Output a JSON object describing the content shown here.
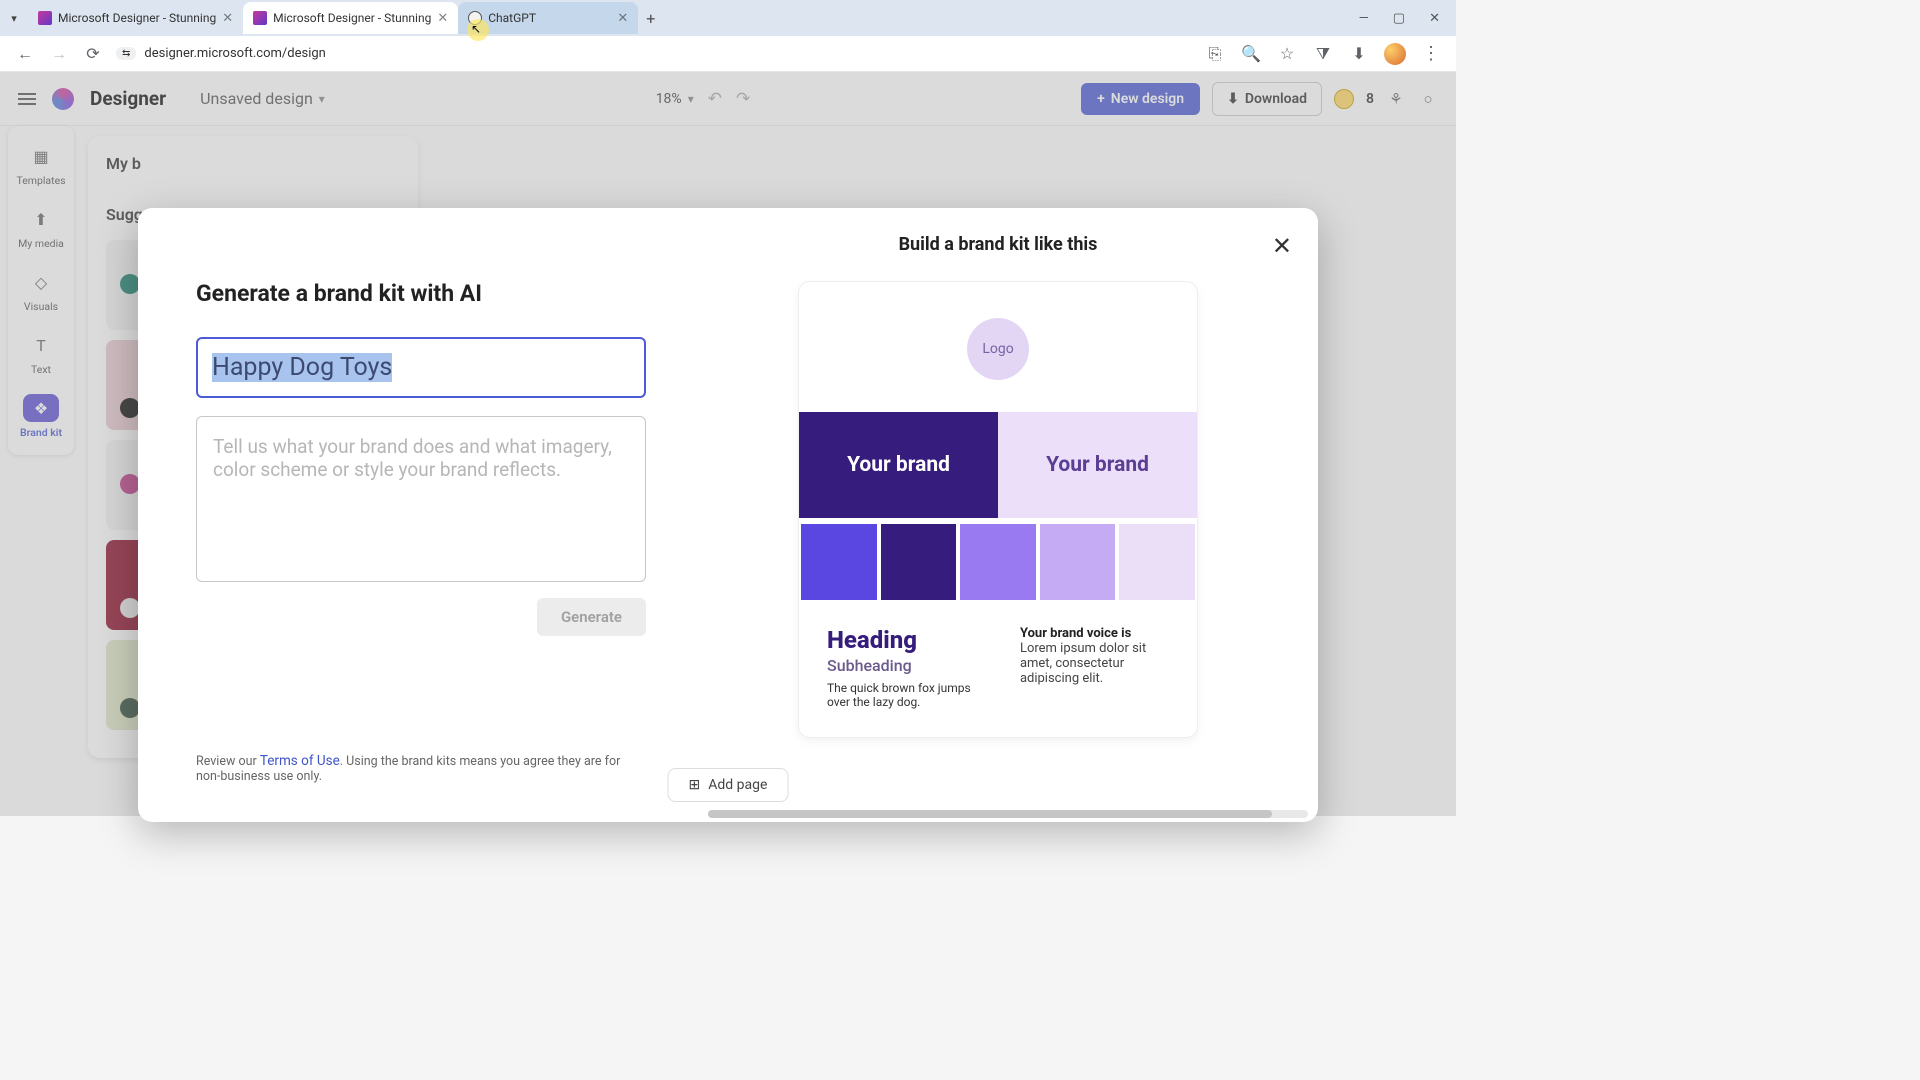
{
  "browser": {
    "tabs": [
      {
        "title": "Microsoft Designer - Stunning"
      },
      {
        "title": "Microsoft Designer - Stunning"
      },
      {
        "title": "ChatGPT"
      }
    ],
    "url": "designer.microsoft.com/design"
  },
  "app": {
    "name": "Designer",
    "design_name": "Unsaved design",
    "zoom": "18%",
    "new_design": "New design",
    "download": "Download",
    "credits": "8"
  },
  "rail": {
    "items": [
      "Templates",
      "My media",
      "Visuals",
      "Text",
      "Brand kit"
    ]
  },
  "bg_panel": {
    "title": "My b",
    "sugg": "Sugg"
  },
  "modal": {
    "left_title": "Generate a brand kit with AI",
    "brand_name": "Happy Dog Toys",
    "desc_placeholder": "Tell us what your brand does and what imagery, color scheme or style your brand reflects.",
    "generate": "Generate",
    "legal_pre": "Review our ",
    "legal_link": "Terms of Use",
    "legal_post": ". Using the brand kits means you agree they are for non-business use only.",
    "right_title": "Build a brand kit like this",
    "logo": "Logo",
    "brand_dark": "Your brand",
    "brand_light": "Your brand",
    "palette": [
      "#5a47e2",
      "#361c7d",
      "#9a7af1",
      "#c5abf3",
      "#ebdff8"
    ],
    "heading": "Heading",
    "subheading": "Subheading",
    "sample": "The quick brown fox jumps over the lazy dog.",
    "voice_h": "Your brand voice is",
    "voice_b": "Lorem ipsum dolor sit amet, consectetur adipiscing elit."
  },
  "footer": {
    "add_page": "Add page"
  }
}
